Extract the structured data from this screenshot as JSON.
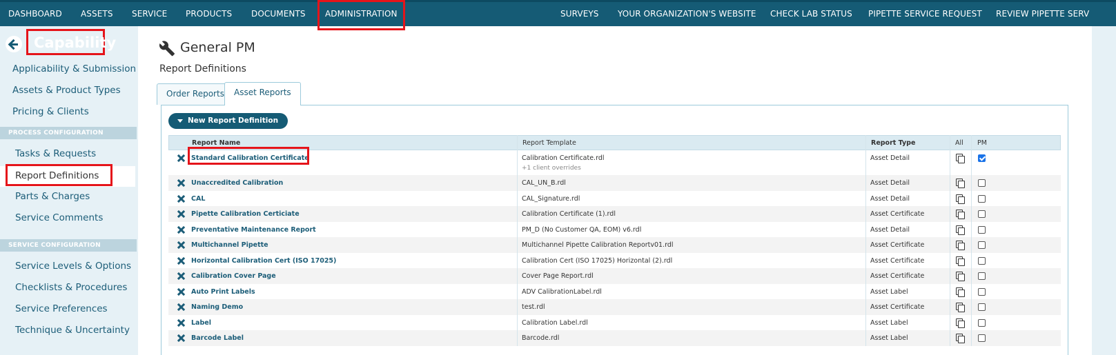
{
  "topnav": {
    "left": [
      "DASHBOARD",
      "ASSETS",
      "SERVICE",
      "PRODUCTS",
      "DOCUMENTS",
      "ADMINISTRATION"
    ],
    "right": [
      "SURVEYS",
      "YOUR ORGANIZATION'S WEBSITE",
      "CHECK LAB STATUS",
      "PIPETTE SERVICE REQUEST",
      "REVIEW PIPETTE SERV"
    ]
  },
  "sidebar": {
    "title": "Capability",
    "top_links": [
      "Applicability & Submission",
      "Assets & Product Types",
      "Pricing & Clients"
    ],
    "section1": "PROCESS CONFIGURATION",
    "section1_links": [
      "Tasks & Requests",
      "Report Definitions",
      "Parts & Charges",
      "Service Comments"
    ],
    "section2": "SERVICE CONFIGURATION",
    "section2_links": [
      "Service Levels & Options",
      "Checklists & Procedures",
      "Service Preferences",
      "Technique & Uncertainty"
    ]
  },
  "main": {
    "title": "General PM",
    "subtitle": "Report Definitions",
    "tabs": [
      "Order Reports",
      "Asset Reports"
    ],
    "new_button": "New Report Definition",
    "columns": [
      "Report Name",
      "Report Template",
      "Report Type",
      "All",
      "PM"
    ],
    "rows": [
      {
        "name": "Standard Calibration Certificate",
        "template": "Calibration Certificate.rdl",
        "note": "+1 client overrides",
        "type": "Asset Detail",
        "pm": true
      },
      {
        "name": "Unaccredited Calibration",
        "template": "CAL_UN_B.rdl",
        "type": "Asset Detail",
        "pm": false
      },
      {
        "name": "CAL",
        "template": "CAL_Signature.rdl",
        "type": "Asset Detail",
        "pm": false
      },
      {
        "name": "Pipette Calibration Certiciate",
        "template": "Calibration Certificate (1).rdl",
        "type": "Asset Certificate",
        "pm": false
      },
      {
        "name": "Preventative Maintenance Report",
        "template": "PM_D (No Customer QA, EOM) v6.rdl",
        "type": "Asset Detail",
        "pm": false
      },
      {
        "name": "Multichannel Pipette",
        "template": "Multichannel Pipette Calibration Reportv01.rdl",
        "type": "Asset Certificate",
        "pm": false
      },
      {
        "name": "Horizontal Calibration Cert (ISO 17025)",
        "template": "Calibration Cert (ISO 17025) Horizontal (2).rdl",
        "type": "Asset Certificate",
        "pm": false
      },
      {
        "name": "Calibration Cover Page",
        "template": "Cover Page Report.rdl",
        "type": "Asset Certificate",
        "pm": false
      },
      {
        "name": "Auto Print Labels",
        "template": "ADV CalibrationLabel.rdl",
        "type": "Asset Label",
        "pm": false
      },
      {
        "name": "Naming Demo",
        "template": "test.rdl",
        "type": "Asset Certificate",
        "pm": false
      },
      {
        "name": "Label",
        "template": "Calibration Label.rdl",
        "type": "Asset Label",
        "pm": false
      },
      {
        "name": "Barcode Label",
        "template": "Barcode.rdl",
        "type": "Asset Label",
        "pm": false
      }
    ]
  },
  "colors": {
    "nav": "#155b75",
    "sidebar": "#e6f1f6",
    "highlight": "#e5141a",
    "link": "#1c5d78"
  }
}
